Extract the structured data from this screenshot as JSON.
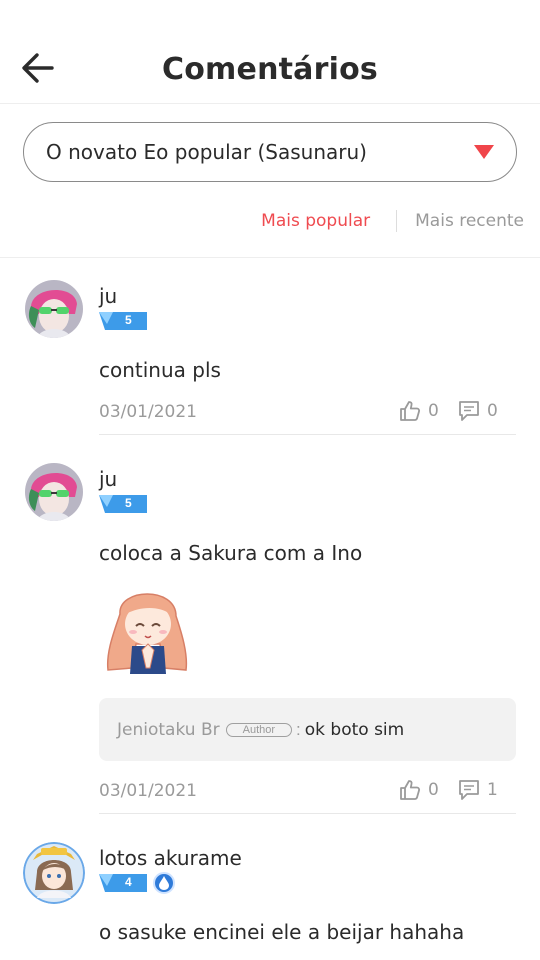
{
  "header": {
    "title": "Comentários"
  },
  "selector": {
    "value": "O novato Eo popular (Sasunaru)"
  },
  "sort": {
    "popular": "Mais popular",
    "recent": "Mais recente"
  },
  "comments": [
    {
      "username": "ju",
      "level": "5",
      "text": "continua pls",
      "date": "03/01/2021",
      "likes": "0",
      "replies": "0"
    },
    {
      "username": "ju",
      "level": "5",
      "text": "coloca a Sakura com a Ino",
      "reply": {
        "author": "Jeniotaku Br",
        "tag": "Author",
        "colon": ":",
        "text": "ok boto sim"
      },
      "date": "03/01/2021",
      "likes": "0",
      "replies": "1"
    },
    {
      "username": "lotos akurame",
      "level": "4",
      "text": "o sasuke encinei ele a beijar hahaha"
    }
  ],
  "colors": {
    "accent": "#ef4b50",
    "muted": "#9a9a9a",
    "badge": "#3d9be9"
  }
}
